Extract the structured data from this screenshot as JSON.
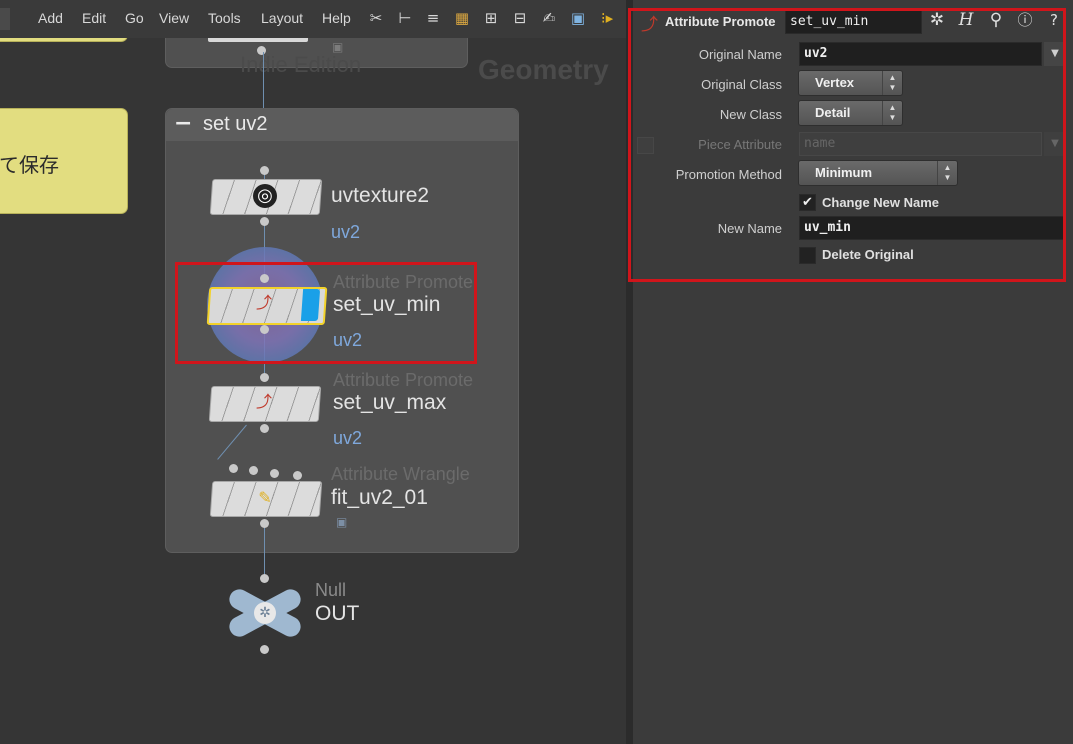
{
  "menubar": {
    "items": [
      "Add",
      "Edit",
      "Go",
      "View",
      "Tools",
      "Layout",
      "Help"
    ],
    "icons": [
      "tools-icon",
      "tree-icon",
      "list-icon",
      "grid-color-icon",
      "grid-icon",
      "layout-icon",
      "notes-icon",
      "image-icon",
      "more-icon"
    ]
  },
  "network": {
    "sticky_text": "て保存",
    "watermark_edition": "Indie Edition",
    "watermark_context": "Geometry",
    "netbox_title": "set uv2",
    "netbox_collapse": "−",
    "nodes": [
      {
        "type": "",
        "name": "uvtexture2",
        "attr": "uv2"
      },
      {
        "type": "Attribute Promote",
        "name": "set_uv_min",
        "attr": "uv2"
      },
      {
        "type": "Attribute Promote",
        "name": "set_uv_max",
        "attr": "uv2"
      },
      {
        "type": "Attribute Wrangle",
        "name": "fit_uv2_01",
        "attr": ""
      },
      {
        "type": "Null",
        "name": "OUT",
        "attr": ""
      }
    ]
  },
  "params": {
    "header": {
      "node_type": "Attribute Promote",
      "node_name": "set_uv_min",
      "icons": [
        "gear-icon",
        "houdini-h-icon",
        "search-icon",
        "info-icon",
        "help-icon"
      ]
    },
    "original_name": {
      "label": "Original Name",
      "value": "uv2"
    },
    "original_class": {
      "label": "Original Class",
      "value": "Vertex"
    },
    "new_class": {
      "label": "New Class",
      "value": "Detail"
    },
    "piece_attribute": {
      "label": "Piece Attribute",
      "placeholder": "name"
    },
    "promotion_method": {
      "label": "Promotion Method",
      "value": "Minimum"
    },
    "change_new_name": {
      "label": "Change New Name",
      "checked": true
    },
    "new_name": {
      "label": "New Name",
      "value": "uv_min"
    },
    "delete_original": {
      "label": "Delete Original",
      "checked": false
    }
  },
  "colors": {
    "highlight": "#d0151b",
    "selected_node": "#f2d22a",
    "attr_text": "#7fa8dc",
    "sticky": "#e2dd80"
  }
}
